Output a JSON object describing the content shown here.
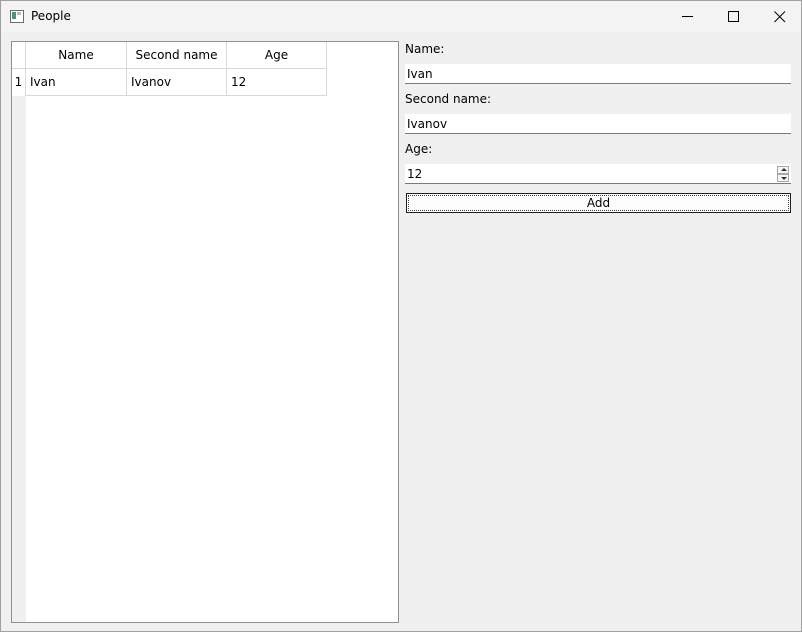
{
  "window": {
    "title": "People",
    "icon": "app-window-icon"
  },
  "controls": {
    "minimize": "minimize-icon",
    "maximize": "maximize-icon",
    "close": "close-icon"
  },
  "table": {
    "columns": [
      "Name",
      "Second name",
      "Age"
    ],
    "rows": [
      {
        "index": "1",
        "cells": [
          "Ivan",
          "Ivanov",
          "12"
        ]
      }
    ]
  },
  "form": {
    "name_label": "Name:",
    "name_value": "Ivan",
    "second_label": "Second name:",
    "second_value": "Ivanov",
    "age_label": "Age:",
    "age_value": "12",
    "add_label": "Add"
  }
}
